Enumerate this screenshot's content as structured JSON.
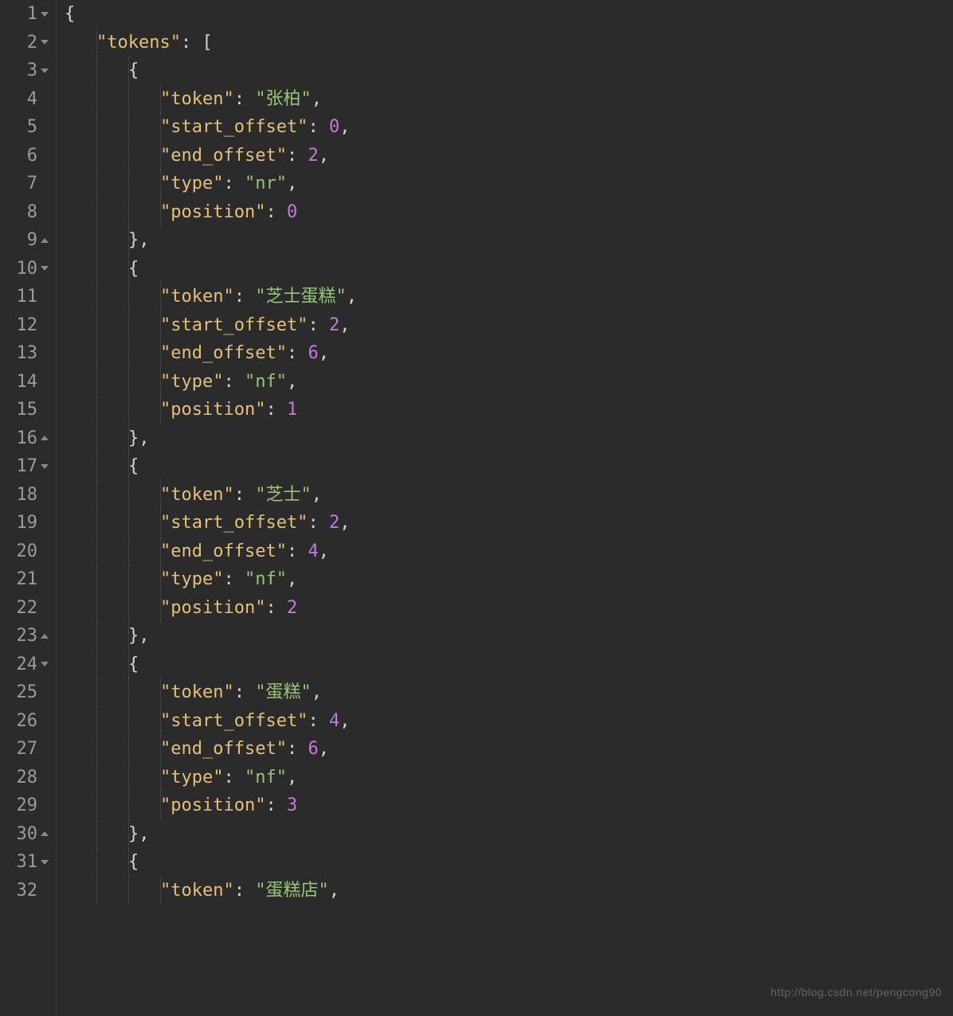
{
  "lines": [
    {
      "num": "1",
      "fold": "down",
      "indent": 0,
      "tokens": [
        {
          "t": "brace",
          "v": "{"
        }
      ]
    },
    {
      "num": "2",
      "fold": "down",
      "indent": 1,
      "tokens": [
        {
          "t": "key",
          "v": "\"tokens\""
        },
        {
          "t": "punct",
          "v": ": ["
        }
      ]
    },
    {
      "num": "3",
      "fold": "down",
      "indent": 2,
      "tokens": [
        {
          "t": "brace",
          "v": "{"
        }
      ]
    },
    {
      "num": "4",
      "fold": "",
      "indent": 3,
      "tokens": [
        {
          "t": "key",
          "v": "\"token\""
        },
        {
          "t": "punct",
          "v": ": "
        },
        {
          "t": "str",
          "v": "\"张柏\""
        },
        {
          "t": "punct",
          "v": ","
        }
      ]
    },
    {
      "num": "5",
      "fold": "",
      "indent": 3,
      "tokens": [
        {
          "t": "key",
          "v": "\"start_offset\""
        },
        {
          "t": "punct",
          "v": ": "
        },
        {
          "t": "num",
          "v": "0"
        },
        {
          "t": "punct",
          "v": ","
        }
      ]
    },
    {
      "num": "6",
      "fold": "",
      "indent": 3,
      "tokens": [
        {
          "t": "key",
          "v": "\"end_offset\""
        },
        {
          "t": "punct",
          "v": ": "
        },
        {
          "t": "num",
          "v": "2"
        },
        {
          "t": "punct",
          "v": ","
        }
      ]
    },
    {
      "num": "7",
      "fold": "",
      "indent": 3,
      "tokens": [
        {
          "t": "key",
          "v": "\"type\""
        },
        {
          "t": "punct",
          "v": ": "
        },
        {
          "t": "str",
          "v": "\"nr\""
        },
        {
          "t": "punct",
          "v": ","
        }
      ]
    },
    {
      "num": "8",
      "fold": "",
      "indent": 3,
      "tokens": [
        {
          "t": "key",
          "v": "\"position\""
        },
        {
          "t": "punct",
          "v": ": "
        },
        {
          "t": "num",
          "v": "0"
        }
      ]
    },
    {
      "num": "9",
      "fold": "up",
      "indent": 2,
      "tokens": [
        {
          "t": "brace",
          "v": "},"
        }
      ]
    },
    {
      "num": "10",
      "fold": "down",
      "indent": 2,
      "tokens": [
        {
          "t": "brace",
          "v": "{"
        }
      ]
    },
    {
      "num": "11",
      "fold": "",
      "indent": 3,
      "tokens": [
        {
          "t": "key",
          "v": "\"token\""
        },
        {
          "t": "punct",
          "v": ": "
        },
        {
          "t": "str",
          "v": "\"芝士蛋糕\""
        },
        {
          "t": "punct",
          "v": ","
        }
      ]
    },
    {
      "num": "12",
      "fold": "",
      "indent": 3,
      "tokens": [
        {
          "t": "key",
          "v": "\"start_offset\""
        },
        {
          "t": "punct",
          "v": ": "
        },
        {
          "t": "num",
          "v": "2"
        },
        {
          "t": "punct",
          "v": ","
        }
      ]
    },
    {
      "num": "13",
      "fold": "",
      "indent": 3,
      "tokens": [
        {
          "t": "key",
          "v": "\"end_offset\""
        },
        {
          "t": "punct",
          "v": ": "
        },
        {
          "t": "num",
          "v": "6"
        },
        {
          "t": "punct",
          "v": ","
        }
      ]
    },
    {
      "num": "14",
      "fold": "",
      "indent": 3,
      "tokens": [
        {
          "t": "key",
          "v": "\"type\""
        },
        {
          "t": "punct",
          "v": ": "
        },
        {
          "t": "str",
          "v": "\"nf\""
        },
        {
          "t": "punct",
          "v": ","
        }
      ]
    },
    {
      "num": "15",
      "fold": "",
      "indent": 3,
      "tokens": [
        {
          "t": "key",
          "v": "\"position\""
        },
        {
          "t": "punct",
          "v": ": "
        },
        {
          "t": "num",
          "v": "1"
        }
      ]
    },
    {
      "num": "16",
      "fold": "up",
      "indent": 2,
      "tokens": [
        {
          "t": "brace",
          "v": "},"
        }
      ]
    },
    {
      "num": "17",
      "fold": "down",
      "indent": 2,
      "tokens": [
        {
          "t": "brace",
          "v": "{"
        }
      ]
    },
    {
      "num": "18",
      "fold": "",
      "indent": 3,
      "tokens": [
        {
          "t": "key",
          "v": "\"token\""
        },
        {
          "t": "punct",
          "v": ": "
        },
        {
          "t": "str",
          "v": "\"芝士\""
        },
        {
          "t": "punct",
          "v": ","
        }
      ]
    },
    {
      "num": "19",
      "fold": "",
      "indent": 3,
      "tokens": [
        {
          "t": "key",
          "v": "\"start_offset\""
        },
        {
          "t": "punct",
          "v": ": "
        },
        {
          "t": "num",
          "v": "2"
        },
        {
          "t": "punct",
          "v": ","
        }
      ]
    },
    {
      "num": "20",
      "fold": "",
      "indent": 3,
      "tokens": [
        {
          "t": "key",
          "v": "\"end_offset\""
        },
        {
          "t": "punct",
          "v": ": "
        },
        {
          "t": "num",
          "v": "4"
        },
        {
          "t": "punct",
          "v": ","
        }
      ]
    },
    {
      "num": "21",
      "fold": "",
      "indent": 3,
      "tokens": [
        {
          "t": "key",
          "v": "\"type\""
        },
        {
          "t": "punct",
          "v": ": "
        },
        {
          "t": "str",
          "v": "\"nf\""
        },
        {
          "t": "punct",
          "v": ","
        }
      ]
    },
    {
      "num": "22",
      "fold": "",
      "indent": 3,
      "tokens": [
        {
          "t": "key",
          "v": "\"position\""
        },
        {
          "t": "punct",
          "v": ": "
        },
        {
          "t": "num",
          "v": "2"
        }
      ]
    },
    {
      "num": "23",
      "fold": "up",
      "indent": 2,
      "tokens": [
        {
          "t": "brace",
          "v": "},"
        }
      ]
    },
    {
      "num": "24",
      "fold": "down",
      "indent": 2,
      "tokens": [
        {
          "t": "brace",
          "v": "{"
        }
      ]
    },
    {
      "num": "25",
      "fold": "",
      "indent": 3,
      "tokens": [
        {
          "t": "key",
          "v": "\"token\""
        },
        {
          "t": "punct",
          "v": ": "
        },
        {
          "t": "str",
          "v": "\"蛋糕\""
        },
        {
          "t": "punct",
          "v": ","
        }
      ]
    },
    {
      "num": "26",
      "fold": "",
      "indent": 3,
      "tokens": [
        {
          "t": "key",
          "v": "\"start_offset\""
        },
        {
          "t": "punct",
          "v": ": "
        },
        {
          "t": "num",
          "v": "4"
        },
        {
          "t": "punct",
          "v": ","
        }
      ]
    },
    {
      "num": "27",
      "fold": "",
      "indent": 3,
      "tokens": [
        {
          "t": "key",
          "v": "\"end_offset\""
        },
        {
          "t": "punct",
          "v": ": "
        },
        {
          "t": "num",
          "v": "6"
        },
        {
          "t": "punct",
          "v": ","
        }
      ]
    },
    {
      "num": "28",
      "fold": "",
      "indent": 3,
      "tokens": [
        {
          "t": "key",
          "v": "\"type\""
        },
        {
          "t": "punct",
          "v": ": "
        },
        {
          "t": "str",
          "v": "\"nf\""
        },
        {
          "t": "punct",
          "v": ","
        }
      ]
    },
    {
      "num": "29",
      "fold": "",
      "indent": 3,
      "tokens": [
        {
          "t": "key",
          "v": "\"position\""
        },
        {
          "t": "punct",
          "v": ": "
        },
        {
          "t": "num",
          "v": "3"
        }
      ]
    },
    {
      "num": "30",
      "fold": "up",
      "indent": 2,
      "tokens": [
        {
          "t": "brace",
          "v": "},"
        }
      ]
    },
    {
      "num": "31",
      "fold": "down",
      "indent": 2,
      "tokens": [
        {
          "t": "brace",
          "v": "{"
        }
      ]
    },
    {
      "num": "32",
      "fold": "",
      "indent": 3,
      "tokens": [
        {
          "t": "key",
          "v": "\"token\""
        },
        {
          "t": "punct",
          "v": ": "
        },
        {
          "t": "str",
          "v": "\"蛋糕店\""
        },
        {
          "t": "punct",
          "v": ","
        }
      ]
    }
  ],
  "watermark": "http://blog.csdn.net/pengcong90"
}
